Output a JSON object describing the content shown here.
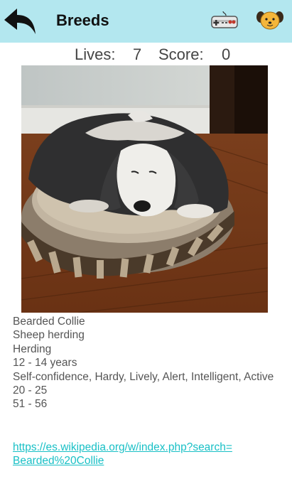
{
  "header": {
    "title": "Breeds",
    "back_icon": "back-arrow-icon",
    "controller_icon": "game-controller-icon",
    "mascot_icon": "dog-face-icon"
  },
  "stats": {
    "lives_label": "Lives:",
    "lives_value": "7",
    "score_label": "Score:",
    "score_value": "0"
  },
  "image": {
    "subject": "dog-photo"
  },
  "breed": {
    "name": "Bearded Collie",
    "bred_for": "Sheep herding",
    "group": "Herding",
    "life_span": "12 - 14 years",
    "temperament": "Self-confidence, Hardy, Lively, Alert, Intelligent, Active",
    "weight": "20 - 25",
    "height": "51 - 56",
    "link_line1": "https://es.wikipedia.org/w/index.php?search=",
    "link_line2": "Bearded%20Collie"
  },
  "colors": {
    "appbar": "#b3e7ef",
    "link": "#19c0c6",
    "text": "#555555"
  }
}
